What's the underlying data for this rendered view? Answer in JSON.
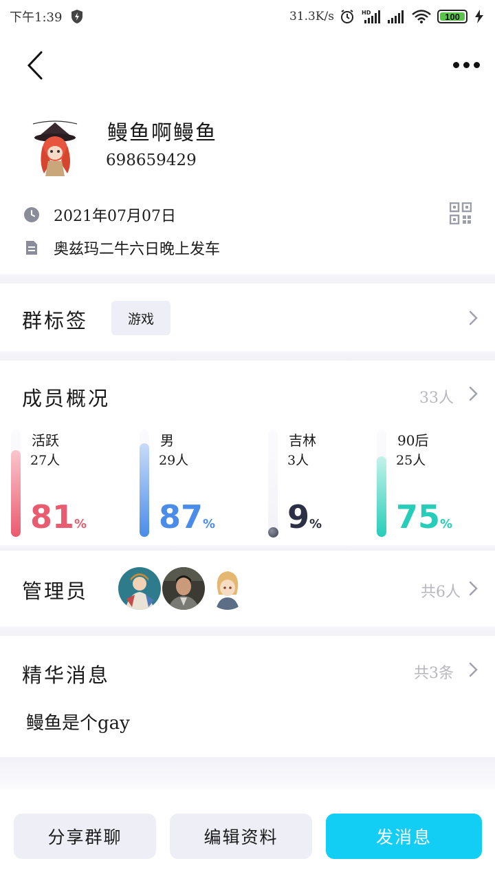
{
  "status_bar": {
    "time": "下午1:39",
    "speed": "31.3K/s",
    "battery": "100"
  },
  "profile": {
    "name": "鳗鱼啊鳗鱼",
    "group_id": "698659429",
    "date": "2021年07月07日",
    "description": "奥兹玛二牛六日晚上发车"
  },
  "tags": {
    "title": "群标签",
    "items": [
      "游戏"
    ]
  },
  "members": {
    "title": "成员概况",
    "total": "33人",
    "stats": [
      {
        "label": "活跃",
        "count": "27人",
        "percent": "81",
        "unit": "%",
        "value": 81,
        "color": "#e95b6e",
        "color_light": "#f9c6cd"
      },
      {
        "label": "男",
        "count": "29人",
        "percent": "87",
        "unit": "%",
        "value": 87,
        "color": "#4a8ce8",
        "color_light": "#c9dcf8"
      },
      {
        "label": "吉林",
        "count": "3人",
        "percent": "9",
        "unit": "%",
        "value": 9,
        "color": "#2d3045",
        "color_light": "#b7bac6"
      },
      {
        "label": "90后",
        "count": "25人",
        "percent": "75",
        "unit": "%",
        "value": 75,
        "color": "#26cdb9",
        "color_light": "#c5f2ea"
      }
    ]
  },
  "admins": {
    "title": "管理员",
    "total": "共6人"
  },
  "featured": {
    "title": "精华消息",
    "total": "共3条",
    "message": "鳗鱼是个gay"
  },
  "actions": {
    "share": "分享群聊",
    "edit": "编辑资料",
    "send": "发消息"
  }
}
